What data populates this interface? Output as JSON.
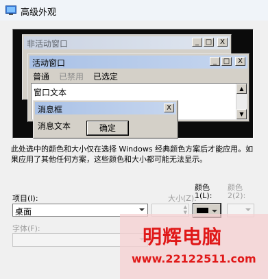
{
  "window": {
    "title": "高级外观"
  },
  "preview": {
    "inactive_window": {
      "title": "非活动窗口",
      "controls": [
        "_",
        "□",
        "X"
      ]
    },
    "active_window": {
      "title": "活动窗口",
      "controls": [
        "_",
        "□",
        "X"
      ],
      "menu": {
        "normal": "普通",
        "disabled": "已禁用",
        "selected": "已选定"
      },
      "window_text": "窗口文本"
    },
    "message_box": {
      "title": "消息框",
      "close": "X",
      "text": "消息文本",
      "ok_button": "确定"
    }
  },
  "description": "此处选中的颜色和大小仅在选择 Windows 经典颜色方案后才能应用。如果应用了其他任何方案，这些颜色和大小都可能无法显示。",
  "item": {
    "label": "项目(I):",
    "value": "桌面"
  },
  "size": {
    "label": "大小(Z):"
  },
  "color1": {
    "label_line1": "颜色",
    "label_line2": "1(L):",
    "value": "#000000"
  },
  "color2": {
    "label_line1": "颜色",
    "label_line2": "2(2):"
  },
  "font": {
    "label": "字体(F):"
  },
  "watermark": {
    "title": "明辉电脑",
    "url": "www.22122511.com"
  },
  "colors": {
    "titlebar_bg": "#f0f4f9",
    "client_bg": "#f0f0f0",
    "preview_bg": "#0b0b0b",
    "active_caption": "#a9c1e6",
    "inactive_caption": "#cbd3e2",
    "watermark_red": "#e01818"
  }
}
